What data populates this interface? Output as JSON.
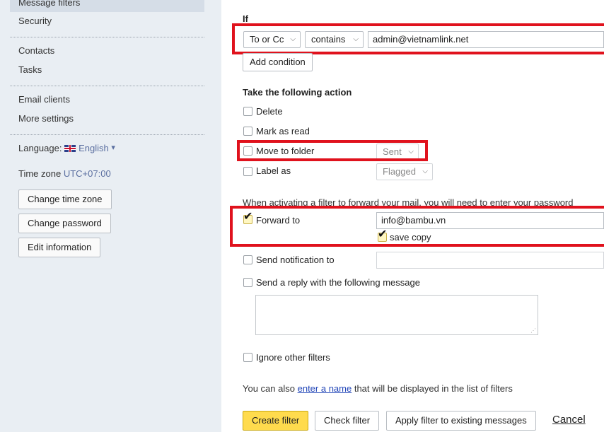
{
  "sidebar": {
    "top_partial": "Message filters",
    "security": "Security",
    "contacts": "Contacts",
    "tasks": "Tasks",
    "email_clients": "Email clients",
    "more_settings": "More settings",
    "language_label": "Language:",
    "language_value": "English",
    "language_caret": "▾",
    "timezone_label": "Time zone",
    "timezone_value": "UTC+07:00",
    "btn_change_timezone": "Change time zone",
    "btn_change_password": "Change password",
    "btn_edit_information": "Edit information"
  },
  "filter": {
    "if_heading": "If",
    "condition_field": "To or Cc",
    "condition_operator": "contains",
    "condition_value": "admin@vietnamlink.net",
    "add_condition": "Add condition",
    "action_heading": "Take the following action",
    "delete_label": "Delete",
    "mark_read_label": "Mark as read",
    "move_folder_label": "Move to folder",
    "move_folder_value": "Sent",
    "label_as_label": "Label as",
    "label_as_value": "Flagged",
    "forward_notice": "When activating a filter to forward your mail, you will need to enter your password",
    "forward_label": "Forward to",
    "forward_value": "info@bambu.vn",
    "save_copy_label": "save copy",
    "notify_label": "Send notification to",
    "notify_value": "",
    "reply_label": "Send a reply with the following message",
    "ignore_label": "Ignore other filters",
    "name_prefix": "You can also",
    "name_link": "enter a name",
    "name_suffix": "that will be displayed in the list of filters"
  },
  "actions": {
    "create": "Create filter",
    "check": "Check filter",
    "apply_existing": "Apply filter to existing messages",
    "cancel": "Cancel"
  },
  "colors": {
    "sidebar_bg": "#e9eef3",
    "highlight_red": "#e0121d",
    "primary_yellow": "#ffdb4d",
    "link_blue": "#2246b8"
  }
}
